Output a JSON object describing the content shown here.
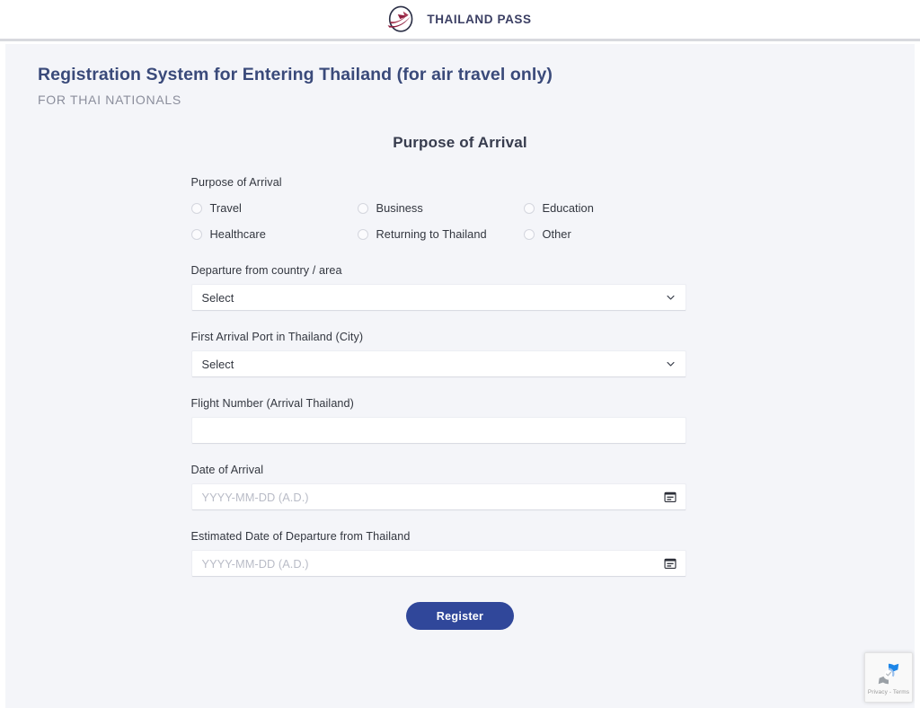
{
  "header": {
    "logo_icon": "thailand-pass-globe-bird-logo",
    "brand": "THAILAND PASS"
  },
  "page": {
    "title": "Registration System for Entering Thailand (for air travel only)",
    "subtitle": "FOR THAI NATIONALS",
    "section_title": "Purpose of Arrival"
  },
  "form": {
    "purpose": {
      "label": "Purpose of Arrival",
      "options": [
        {
          "value": "travel",
          "label": "Travel",
          "selected": false
        },
        {
          "value": "business",
          "label": "Business",
          "selected": false
        },
        {
          "value": "education",
          "label": "Education",
          "selected": false
        },
        {
          "value": "healthcare",
          "label": "Healthcare",
          "selected": false
        },
        {
          "value": "returning",
          "label": "Returning to Thailand",
          "selected": false
        },
        {
          "value": "other",
          "label": "Other",
          "selected": false
        }
      ]
    },
    "departure_country": {
      "label": "Departure from country / area",
      "value": "Select",
      "icon": "chevron-down-icon"
    },
    "arrival_port": {
      "label": "First Arrival Port in Thailand (City)",
      "value": "Select",
      "icon": "chevron-down-icon"
    },
    "flight_number": {
      "label": "Flight Number (Arrival Thailand)",
      "value": "",
      "placeholder": ""
    },
    "date_of_arrival": {
      "label": "Date of Arrival",
      "value": "",
      "placeholder": "YYYY-MM-DD (A.D.)",
      "icon": "calendar-icon"
    },
    "date_of_departure": {
      "label": "Estimated Date of Departure from Thailand",
      "value": "",
      "placeholder": "YYYY-MM-DD (A.D.)",
      "icon": "calendar-icon"
    },
    "submit": {
      "label": "Register"
    }
  },
  "recaptcha": {
    "icon": "recaptcha-logo",
    "text": "Privacy - Terms"
  },
  "colors": {
    "brand_navy": "#3a4a7a",
    "button_blue": "#30479a",
    "logo_maroon": "#8f1f3f",
    "page_bg": "#f4f5f9"
  }
}
